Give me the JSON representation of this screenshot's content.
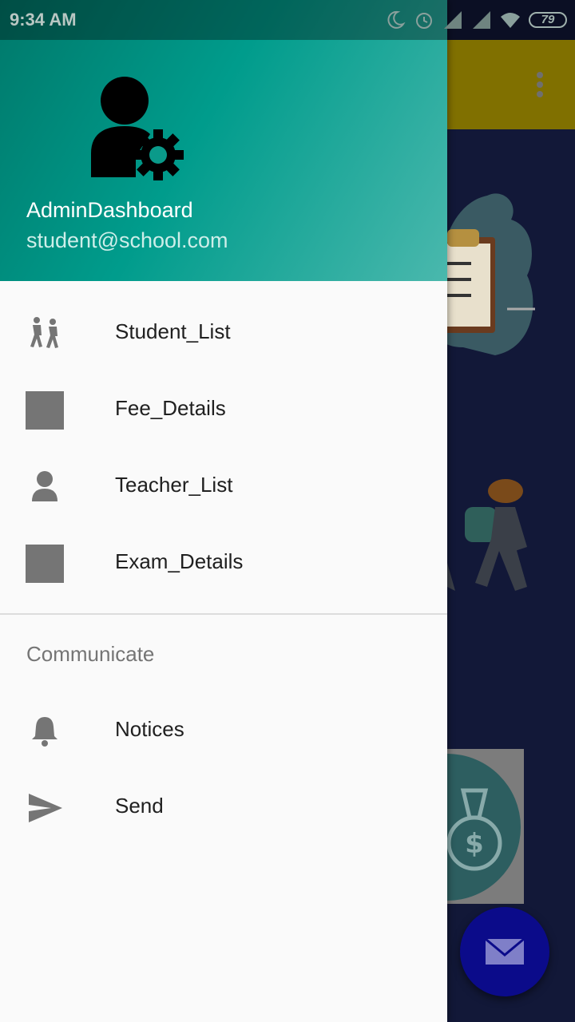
{
  "status_bar": {
    "time": "9:34 AM",
    "battery": "79",
    "icons": [
      "moon-icon",
      "alarm-icon",
      "signal-icon",
      "signal-icon",
      "wifi-icon",
      "battery-icon"
    ]
  },
  "drawer": {
    "header": {
      "name": "AdminDashboard",
      "email": "student@school.com",
      "avatar_icon": "admin-settings-icon"
    },
    "menu": [
      {
        "label": "Student_List",
        "icon": "students-walking-icon"
      },
      {
        "label": "Fee_Details",
        "icon": "placeholder-square-icon"
      },
      {
        "label": "Teacher_List",
        "icon": "person-icon"
      },
      {
        "label": "Exam_Details",
        "icon": "placeholder-square-icon"
      }
    ],
    "section": {
      "title": "Communicate",
      "items": [
        {
          "label": "Notices",
          "icon": "bell-icon"
        },
        {
          "label": "Send",
          "icon": "send-icon"
        }
      ]
    }
  },
  "colors": {
    "header_gradient_start": "#00796b",
    "header_gradient_end": "#4ab8ad",
    "toolbar": "#807000",
    "app_background": "#121838",
    "fab": "#0b0b8a"
  }
}
